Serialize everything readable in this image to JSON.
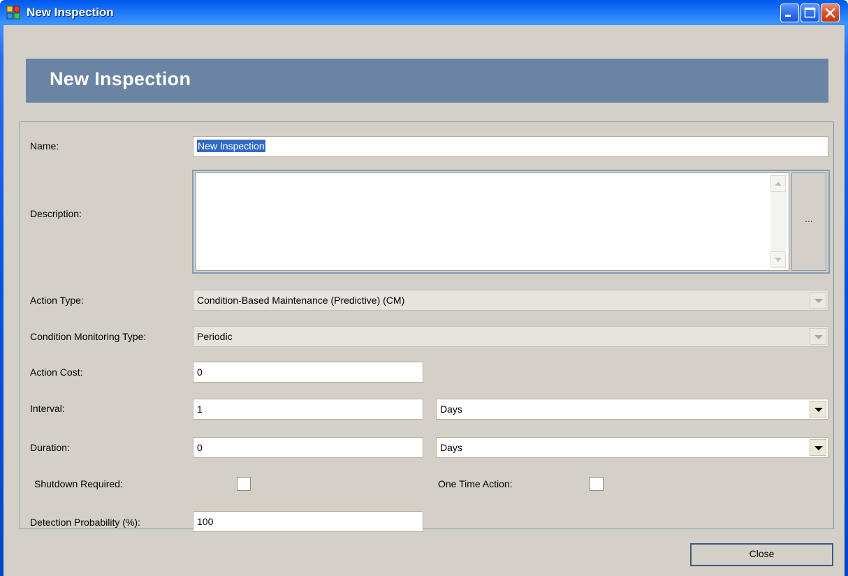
{
  "window": {
    "title": "New Inspection",
    "app_icon": "application-icon",
    "controls": {
      "minimize": "minimize-icon",
      "maximize": "maximize-icon",
      "close": "close-icon"
    }
  },
  "banner": {
    "title": "New Inspection"
  },
  "form": {
    "name": {
      "label": "Name:",
      "value": "New Inspection"
    },
    "description": {
      "label": "Description:",
      "value": "",
      "button_label": "..."
    },
    "action_type": {
      "label": "Action Type:",
      "value": "Condition-Based Maintenance (Predictive) (CM)"
    },
    "cm_type": {
      "label": "Condition Monitoring Type:",
      "value": "Periodic"
    },
    "action_cost": {
      "label": "Action Cost:",
      "value": "0"
    },
    "interval": {
      "label": "Interval:",
      "value": "1",
      "unit": "Days"
    },
    "duration": {
      "label": "Duration:",
      "value": "0",
      "unit": "Days"
    },
    "shutdown_required": {
      "label": "Shutdown Required:",
      "checked": false
    },
    "one_time_action": {
      "label": "One Time Action:",
      "checked": false
    },
    "detection_probability": {
      "label": "Detection Probability (%):",
      "value": "100"
    }
  },
  "footer": {
    "close_label": "Close"
  },
  "colors": {
    "titlebar": "#0153e0",
    "banner": "#6b84a3",
    "client": "#d4d0c8",
    "selection": "#316ac5"
  }
}
